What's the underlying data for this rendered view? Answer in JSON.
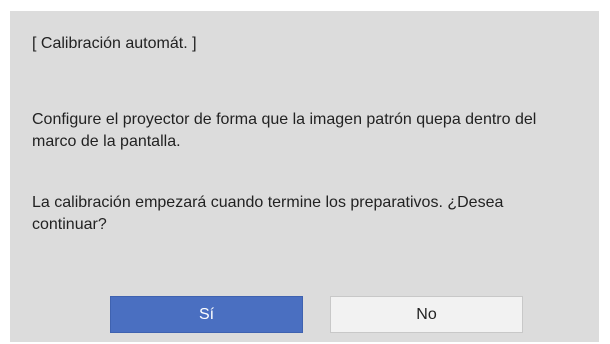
{
  "dialog": {
    "title": "[ Calibración automát. ]",
    "paragraph_1": "Configure el proyector de forma que la imagen patrón quepa dentro del marco de la pantalla.",
    "paragraph_2": "La calibración empezará cuando termine los preparativos. ¿Desea continuar?",
    "buttons": {
      "yes_label": "Sí",
      "no_label": "No"
    }
  },
  "colors": {
    "dialog_background": "#dcdcdc",
    "selected_button": "#4a6fc1",
    "unselected_button": "#f2f2f2",
    "text": "#222222"
  }
}
